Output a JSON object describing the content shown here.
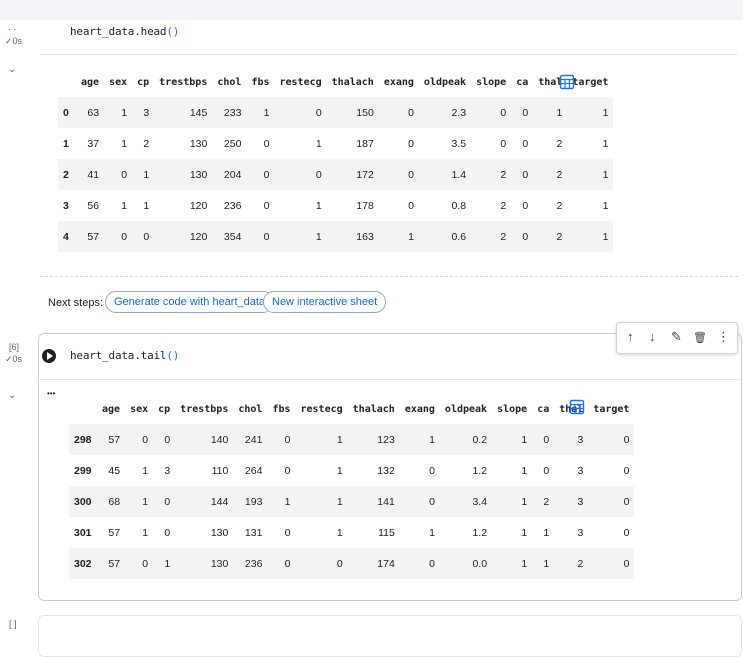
{
  "cell1": {
    "exec_dots": "· ·",
    "exec_status": "✓",
    "exec_time": "0s",
    "code_fn": "heart_data.head",
    "code_paren": "()",
    "columns": [
      "",
      "age",
      "sex",
      "cp",
      "trestbps",
      "chol",
      "fbs",
      "restecg",
      "thalach",
      "exang",
      "oldpeak",
      "slope",
      "ca",
      "thal",
      "target"
    ],
    "rows": [
      [
        "0",
        "63",
        "1",
        "3",
        "145",
        "233",
        "1",
        "0",
        "150",
        "0",
        "2.3",
        "0",
        "0",
        "1",
        "1"
      ],
      [
        "1",
        "37",
        "1",
        "2",
        "130",
        "250",
        "0",
        "1",
        "187",
        "0",
        "3.5",
        "0",
        "0",
        "2",
        "1"
      ],
      [
        "2",
        "41",
        "0",
        "1",
        "130",
        "204",
        "0",
        "0",
        "172",
        "0",
        "1.4",
        "2",
        "0",
        "2",
        "1"
      ],
      [
        "3",
        "56",
        "1",
        "1",
        "120",
        "236",
        "0",
        "1",
        "178",
        "0",
        "0.8",
        "2",
        "0",
        "2",
        "1"
      ],
      [
        "4",
        "57",
        "0",
        "0",
        "120",
        "354",
        "0",
        "1",
        "163",
        "1",
        "0.6",
        "2",
        "0",
        "2",
        "1"
      ]
    ],
    "next_steps_label": "Next steps:",
    "chip_generate": "Generate code with heart_data",
    "chip_sheet": "New interactive sheet"
  },
  "cell2": {
    "exec_count": "[6]",
    "exec_status": "✓",
    "exec_time": "0s",
    "code_fn": "heart_data.tail",
    "code_paren": "()",
    "output_ellipsis": "•••",
    "columns": [
      "",
      "age",
      "sex",
      "cp",
      "trestbps",
      "chol",
      "fbs",
      "restecg",
      "thalach",
      "exang",
      "oldpeak",
      "slope",
      "ca",
      "thal",
      "target"
    ],
    "rows": [
      [
        "298",
        "57",
        "0",
        "0",
        "140",
        "241",
        "0",
        "1",
        "123",
        "1",
        "0.2",
        "1",
        "0",
        "3",
        "0"
      ],
      [
        "299",
        "45",
        "1",
        "3",
        "110",
        "264",
        "0",
        "1",
        "132",
        "0",
        "1.2",
        "1",
        "0",
        "3",
        "0"
      ],
      [
        "300",
        "68",
        "1",
        "0",
        "144",
        "193",
        "1",
        "1",
        "141",
        "0",
        "3.4",
        "1",
        "2",
        "3",
        "0"
      ],
      [
        "301",
        "57",
        "1",
        "0",
        "130",
        "131",
        "0",
        "1",
        "115",
        "1",
        "1.2",
        "1",
        "1",
        "3",
        "0"
      ],
      [
        "302",
        "57",
        "0",
        "1",
        "130",
        "236",
        "0",
        "0",
        "174",
        "0",
        "0.0",
        "1",
        "1",
        "2",
        "0"
      ]
    ]
  },
  "cell3": {
    "exec_count": "[ ]"
  },
  "toolbar": {
    "move_up": "↑",
    "move_down": "↓",
    "magic": "✎",
    "delete": "🗑",
    "more": "⋮"
  },
  "icons": {
    "collapse": "⌄",
    "table": "table-icon",
    "run": "play-circle-icon"
  },
  "colors": {
    "accent": "#1a73e8",
    "success": "#2e7d32",
    "row_stripe": "#f1f3f4"
  }
}
